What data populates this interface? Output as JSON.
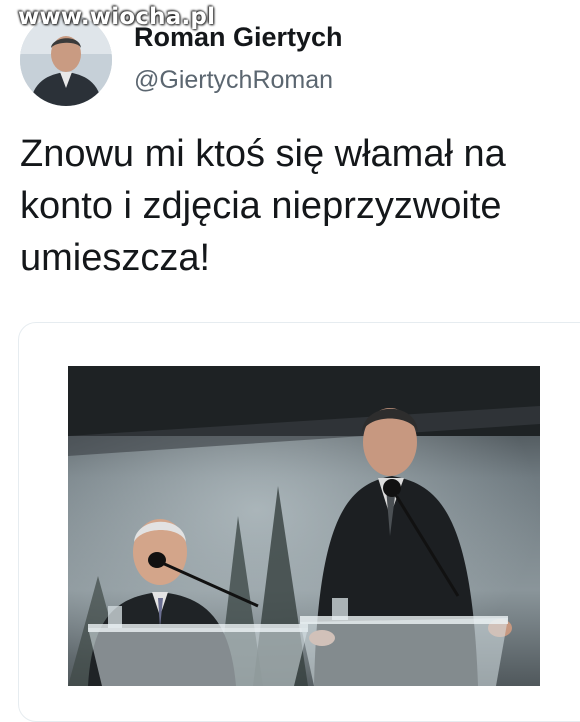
{
  "watermark": "www.wiocha.pl",
  "author": {
    "display_name": "Roman Giertych",
    "handle": "@GiertychRoman"
  },
  "tweet": {
    "text_lines": [
      "Znowu mi ktoś się włamał na",
      "konto i zdjęcia nieprzyzwoite",
      "umieszcza!"
    ]
  },
  "colors": {
    "text": "#14171a",
    "handle": "#5b6670",
    "card_border": "#e6ecf0"
  }
}
